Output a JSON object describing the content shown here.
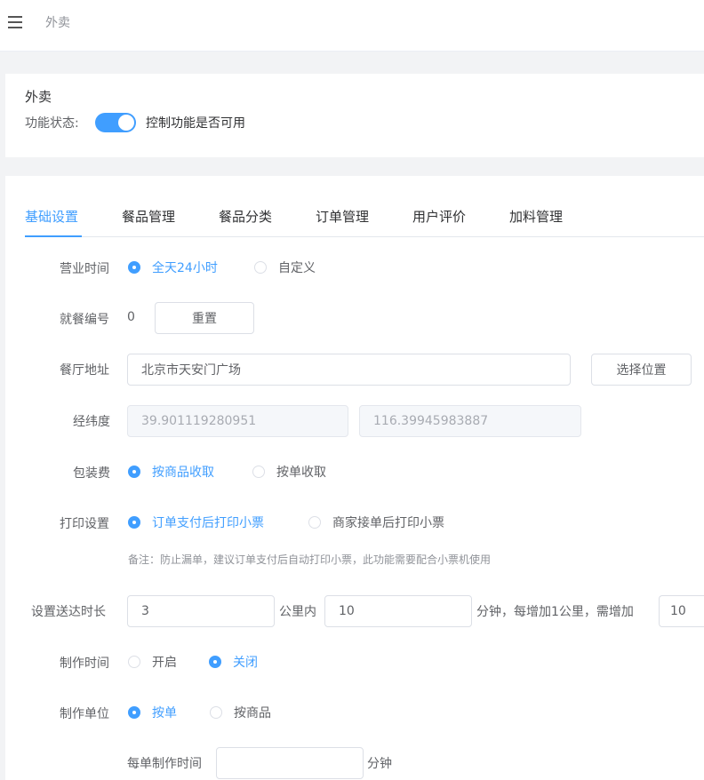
{
  "breadcrumb": {
    "current": "外卖"
  },
  "feature": {
    "title": "外卖",
    "status_label": "功能状态:",
    "enabled": true,
    "status_desc": "控制功能是否可用"
  },
  "tabs": [
    {
      "label": "基础设置",
      "active": true
    },
    {
      "label": "餐品管理",
      "active": false
    },
    {
      "label": "餐品分类",
      "active": false
    },
    {
      "label": "订单管理",
      "active": false
    },
    {
      "label": "用户评价",
      "active": false
    },
    {
      "label": "加料管理",
      "active": false
    }
  ],
  "form": {
    "business_hours": {
      "label": "营业时间",
      "options": [
        "全天24小时",
        "自定义"
      ],
      "selected": 0
    },
    "meal_number": {
      "label": "就餐编号",
      "value": "0",
      "reset_label": "重置"
    },
    "address": {
      "label": "餐厅地址",
      "value": "北京市天安门广场",
      "select_label": "选择位置"
    },
    "coordinates": {
      "label": "经纬度",
      "lat": "39.901119280951",
      "lng": "116.39945983887"
    },
    "packing_fee": {
      "label": "包装费",
      "options": [
        "按商品收取",
        "按单收取"
      ],
      "selected": 0
    },
    "print": {
      "label": "打印设置",
      "options": [
        "订单支付后打印小票",
        "商家接单后打印小票"
      ],
      "selected": 0,
      "note": "备注：防止漏单，建议订单支付后自动打印小票，此功能需要配合小票机使用"
    },
    "delivery": {
      "label": "设置送达时长",
      "distance": "3",
      "unit1": "公里内",
      "minutes": "10",
      "text2": "分钟，每增加1公里，需增加",
      "extra": "10"
    },
    "prep_time": {
      "label": "制作时间",
      "options": [
        "开启",
        "关闭"
      ],
      "selected": 1
    },
    "prep_unit": {
      "label": "制作单位",
      "options": [
        "按单",
        "按商品"
      ],
      "selected": 0
    },
    "per_order": {
      "label": "每单制作时间",
      "value": "",
      "unit": "分钟"
    }
  },
  "colors": {
    "accent": "#409eff",
    "text": "#606266",
    "muted": "#909399"
  }
}
